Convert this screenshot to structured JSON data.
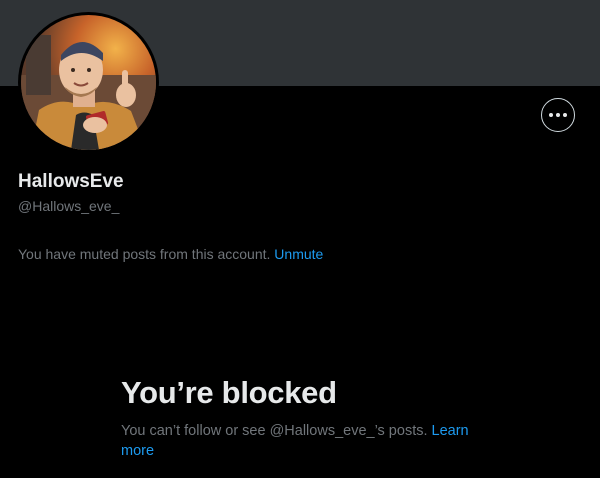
{
  "profile": {
    "display_name": "HallowsEve",
    "handle": "@Hallows_eve_",
    "more_icon": "more-horizontal-icon",
    "avatar_desc": "profile-photo"
  },
  "muted_notice": {
    "text": "You have muted posts from this account.",
    "action": "Unmute"
  },
  "blocked": {
    "title": "You’re blocked",
    "description": "You can’t follow or see @Hallows_eve_’s posts.",
    "learn_more": "Learn more"
  },
  "colors": {
    "background": "#000000",
    "banner": "#2f3336",
    "text_primary": "#e7e9ea",
    "text_secondary": "#71767b",
    "accent": "#1d9bf0"
  }
}
